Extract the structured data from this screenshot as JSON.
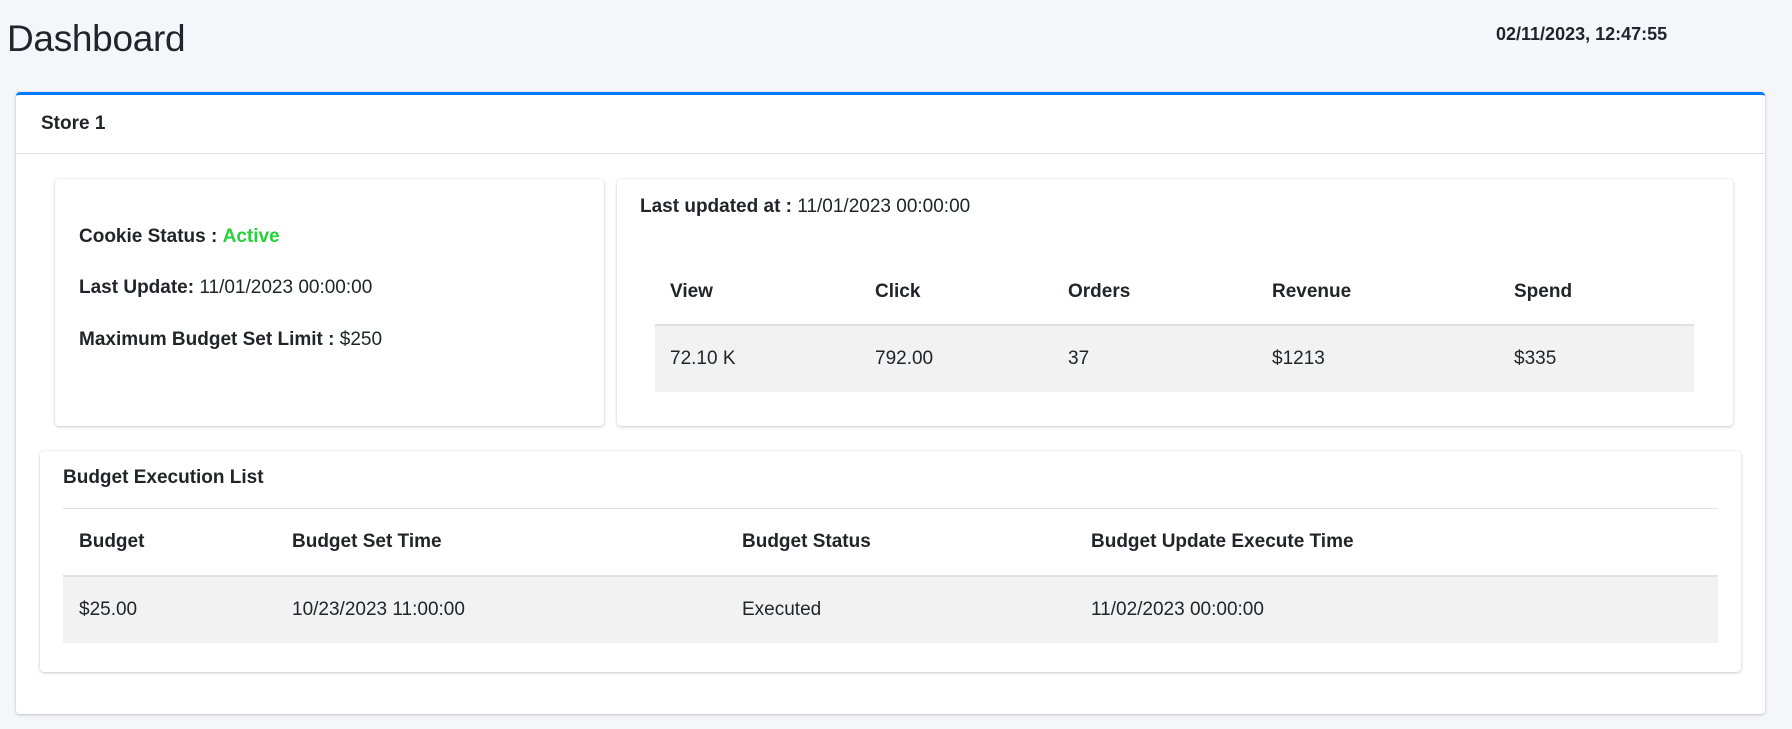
{
  "header": {
    "title": "Dashboard",
    "datetime": "02/11/2023, 12:47:55"
  },
  "store": {
    "title": "Store 1",
    "accent_color": "#007bff"
  },
  "info": {
    "cookie_status_label": "Cookie Status :",
    "cookie_status_value": "Active",
    "cookie_status_color": "#28d13a",
    "last_update_label": "Last Update:",
    "last_update_value": "11/01/2023 00:00:00",
    "max_budget_label": "Maximum Budget Set Limit :",
    "max_budget_value": "$250"
  },
  "stats": {
    "last_updated_label": "Last updated at :",
    "last_updated_value": "11/01/2023 00:00:00",
    "columns": [
      "View",
      "Click",
      "Orders",
      "Revenue",
      "Spend"
    ],
    "rows": [
      [
        "72.10 K",
        "792.00",
        "37",
        "$1213",
        "$335"
      ]
    ]
  },
  "budget": {
    "title": "Budget Execution List",
    "columns": [
      "Budget",
      "Budget Set Time",
      "Budget Status",
      "Budget Update Execute Time"
    ],
    "rows": [
      [
        "$25.00",
        "10/23/2023 11:00:00",
        "Executed",
        "11/02/2023 00:00:00"
      ]
    ]
  }
}
